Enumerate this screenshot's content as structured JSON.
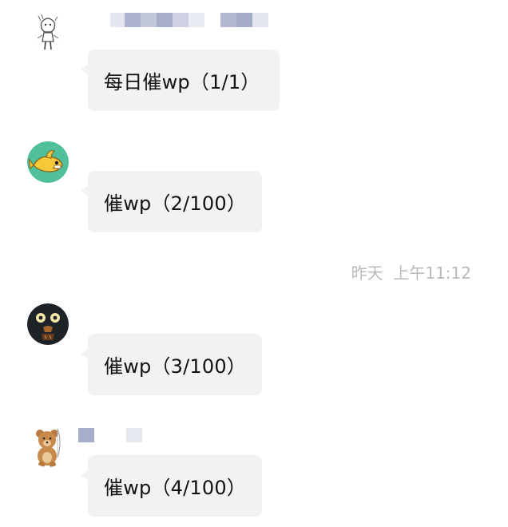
{
  "messages": [
    {
      "sender_avatar": "sketch-girl-avatar",
      "text": "每日催wp（1/1）"
    },
    {
      "sender_avatar": "yellow-fish-avatar",
      "text": "催wp（2/100）"
    },
    {
      "sender_avatar": "dark-bird-avatar",
      "text": "催wp（3/100）"
    },
    {
      "sender_avatar": "teddy-bear-avatar",
      "text": "催wp（4/100）"
    }
  ],
  "divider": {
    "timestamp": "昨天  上午11:12"
  },
  "colors": {
    "bubble_bg": "#f2f2f2",
    "timestamp": "#b9b9b9",
    "name_blur_dark": "#a9b0cc",
    "name_blur_light": "#dfe2ee"
  }
}
